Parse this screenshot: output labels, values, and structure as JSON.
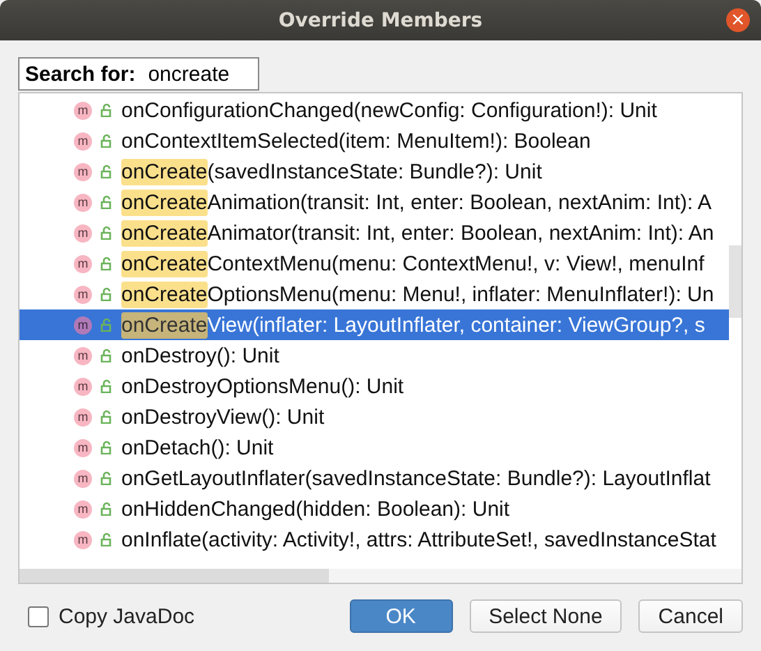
{
  "window": {
    "title": "Override Members",
    "close": "×"
  },
  "search": {
    "label": "Search for:",
    "value": "oncreate"
  },
  "members": [
    {
      "icon": "m",
      "rest": "onConfigurationChanged(newConfig: Configuration!): Unit",
      "selected": false
    },
    {
      "icon": "m",
      "rest": "onContextItemSelected(item: MenuItem!): Boolean",
      "selected": false
    },
    {
      "icon": "m",
      "match": "onCreate",
      "rest": "(savedInstanceState: Bundle?): Unit",
      "selected": false
    },
    {
      "icon": "m",
      "match": "onCreate",
      "rest": "Animation(transit: Int, enter: Boolean, nextAnim: Int): A",
      "selected": false
    },
    {
      "icon": "m",
      "match": "onCreate",
      "rest": "Animator(transit: Int, enter: Boolean, nextAnim: Int): An",
      "selected": false
    },
    {
      "icon": "m",
      "match": "onCreate",
      "rest": "ContextMenu(menu: ContextMenu!, v: View!, menuInf",
      "selected": false
    },
    {
      "icon": "m",
      "match": "onCreate",
      "rest": "OptionsMenu(menu: Menu!, inflater: MenuInflater!): Un",
      "selected": false
    },
    {
      "icon": "m",
      "match": "onCreate",
      "rest": "View(inflater: LayoutInflater, container: ViewGroup?, s",
      "selected": true
    },
    {
      "icon": "m",
      "rest": "onDestroy(): Unit",
      "selected": false
    },
    {
      "icon": "m",
      "rest": "onDestroyOptionsMenu(): Unit",
      "selected": false
    },
    {
      "icon": "m",
      "rest": "onDestroyView(): Unit",
      "selected": false
    },
    {
      "icon": "m",
      "rest": "onDetach(): Unit",
      "selected": false
    },
    {
      "icon": "m",
      "rest": "onGetLayoutInflater(savedInstanceState: Bundle?): LayoutInflat",
      "selected": false
    },
    {
      "icon": "m",
      "rest": "onHiddenChanged(hidden: Boolean): Unit",
      "selected": false
    },
    {
      "icon": "m",
      "rest": "onInflate(activity: Activity!, attrs: AttributeSet!, savedInstanceStat",
      "selected": false
    }
  ],
  "copy_javadoc": {
    "label": "Copy JavaDoc",
    "checked": false
  },
  "buttons": [
    {
      "label": "OK",
      "kind": "primary"
    },
    {
      "label": "Select None",
      "kind": "normal"
    },
    {
      "label": "Cancel",
      "kind": "normal"
    }
  ]
}
